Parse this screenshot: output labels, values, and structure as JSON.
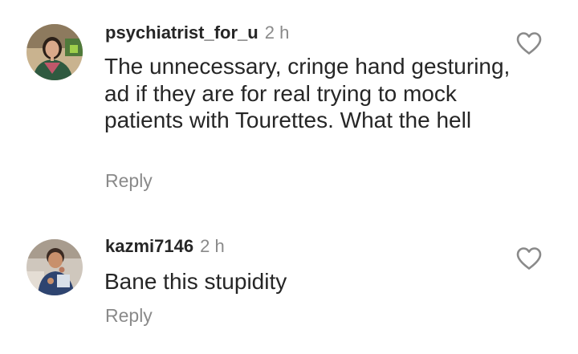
{
  "comments": [
    {
      "username": "psychiatrist_for_u",
      "time": "2 h",
      "text": "The unnecessary, cringe hand gesturing, ad if they are for real trying to mock patients with Tourettes. What the hell",
      "reply_label": "Reply"
    },
    {
      "username": "kazmi7146",
      "time": "2 h",
      "text": "Bane this stupidity",
      "reply_label": "Reply"
    }
  ],
  "icons": {
    "like": "heart-outline-icon"
  },
  "colors": {
    "text": "#262626",
    "muted": "#8a8a8a",
    "background": "#ffffff"
  }
}
